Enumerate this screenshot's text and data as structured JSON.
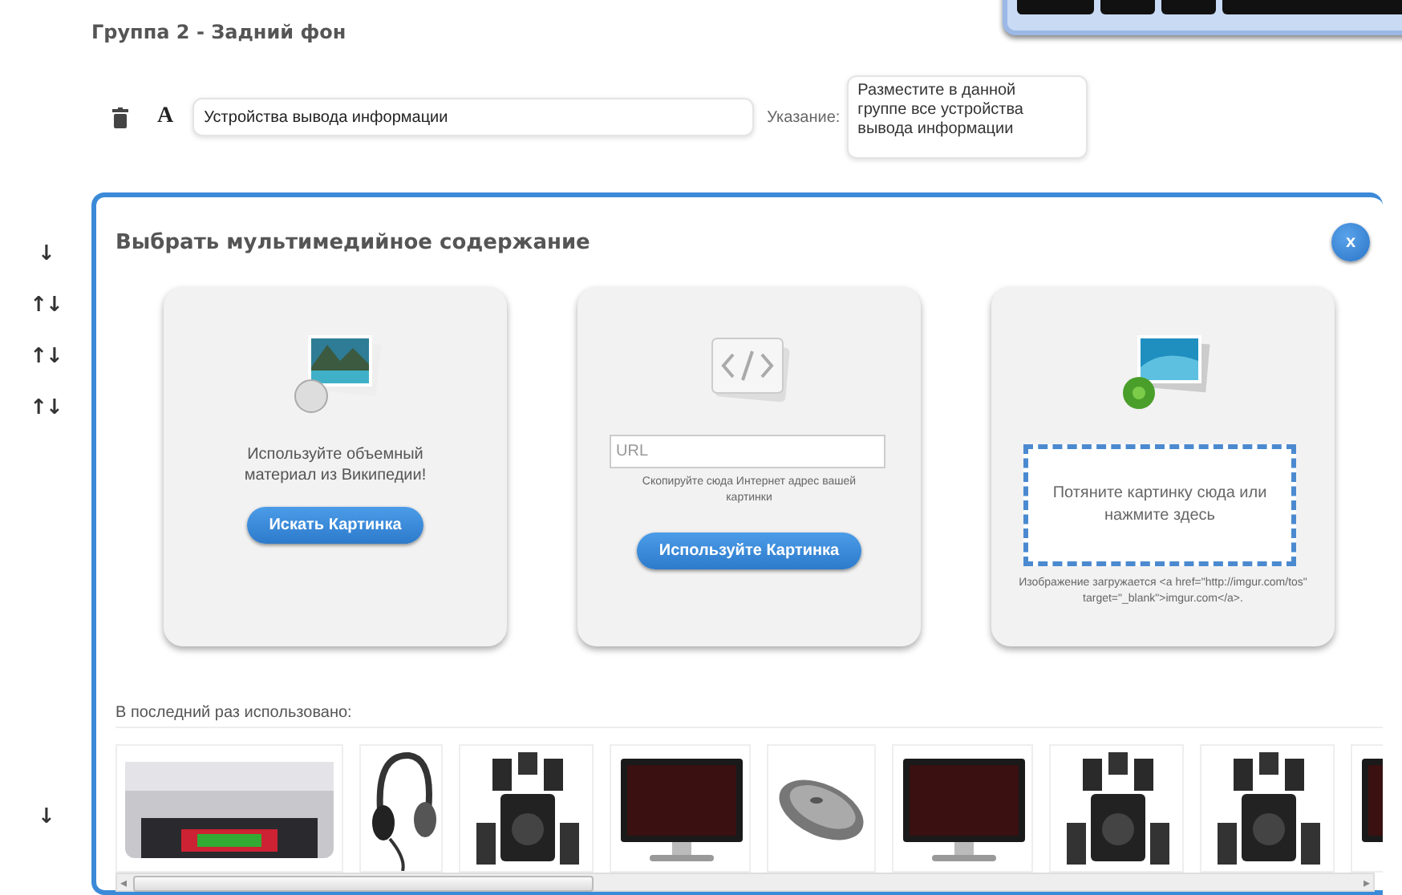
{
  "group_header": "Группа 2 - Задний фон",
  "item_row": {
    "letter": "A",
    "name_field": {
      "value": "Устройства вывода информации"
    },
    "hint_label": "Указание:",
    "hint_field": {
      "value": "Разместите в данной группе все устройства вывода информации"
    }
  },
  "side_arrows": [
    {
      "text": "↓"
    },
    {
      "text": "↑↓"
    },
    {
      "text": "↑↓"
    },
    {
      "text": "↑↓"
    },
    {
      "text": "↓"
    }
  ],
  "dialog": {
    "title": "Выбрать мультимедийное содержание",
    "close": "x",
    "cards": [
      {
        "kind": "wikipedia",
        "text": "Используйте объемный материал из Википедии!",
        "button": "Искать Картинка"
      },
      {
        "kind": "url",
        "placeholder": "URL",
        "text": "Скопируйте сюда Интернет адрес вашей картинки",
        "button": "Используйте Картинка"
      },
      {
        "kind": "upload",
        "drop_text": "Потяните картинку сюда или нажмите здесь",
        "text": "Изображение загружается <a href=\"http://imgur.com/tos\" target=\"_blank\">imgur.com</a>."
      }
    ],
    "recent_label": "В последний раз использовано:",
    "scroll_left": "◂",
    "scroll_right": "▸"
  }
}
